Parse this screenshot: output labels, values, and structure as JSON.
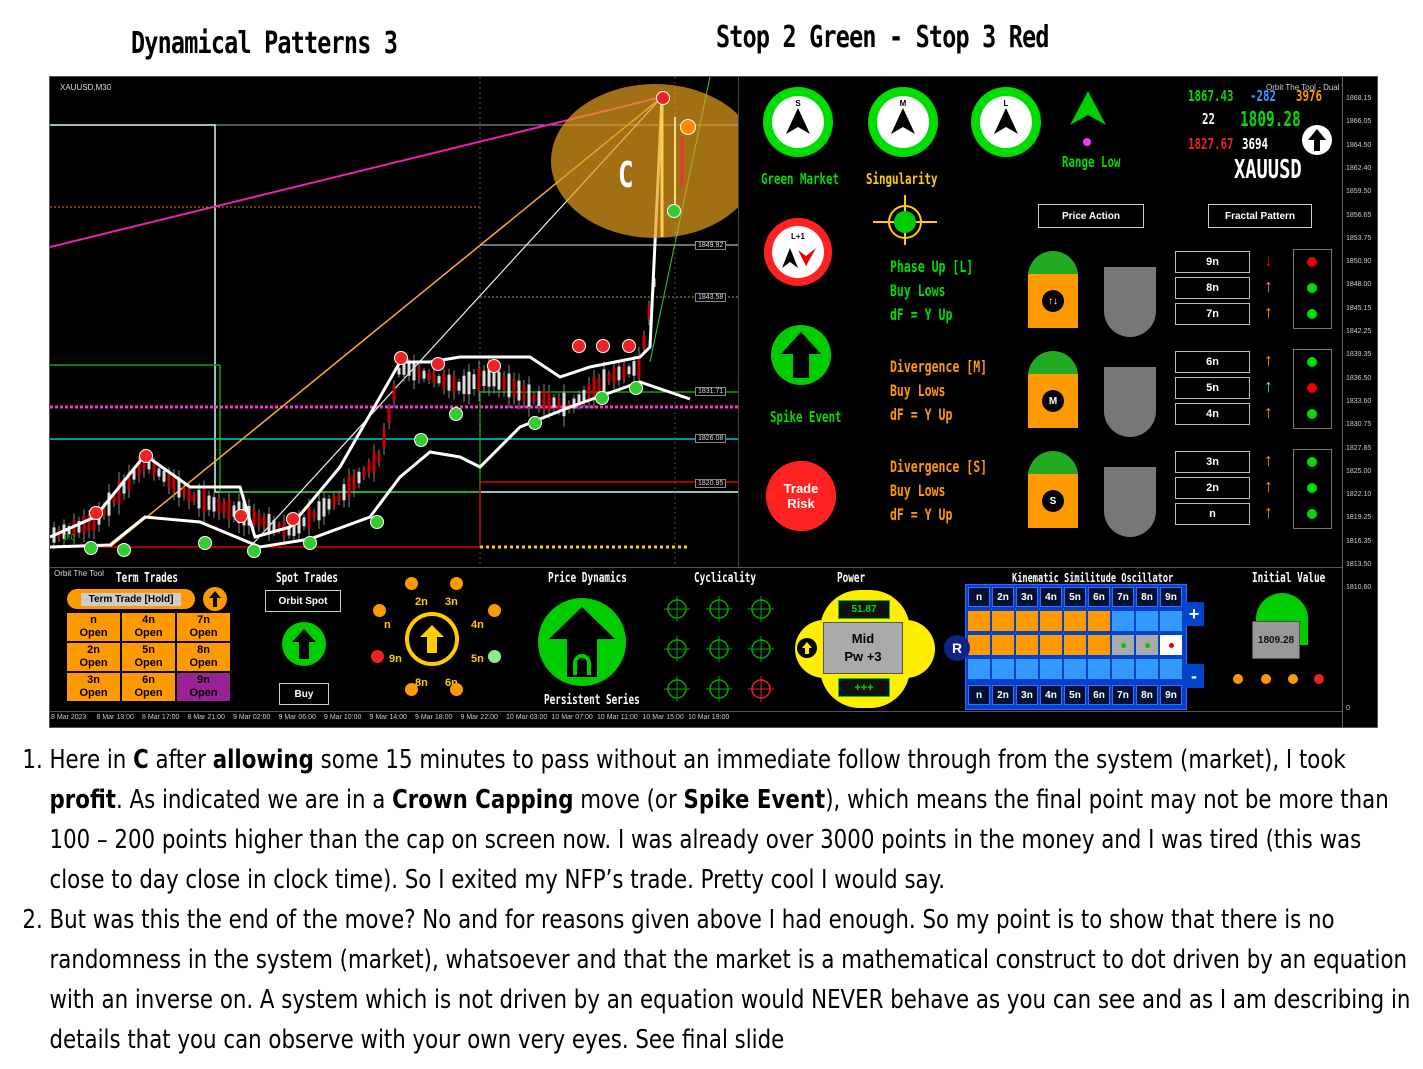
{
  "titles": {
    "left": "Dynamical Patterns 3",
    "right": "Stop 2 Green - Stop 3 Red"
  },
  "chart": {
    "symbol": "XAUUSD,M30",
    "tool_label": "Orbit The Tool - Dual",
    "region_label": "C",
    "price_labels": [
      "1868.15",
      "1866.05",
      "1864.50",
      "1862.40",
      "1859.50",
      "1856.65",
      "1853.75",
      "1850.90",
      "1848.00",
      "1845.15",
      "1842.25",
      "1839.35",
      "1836.50",
      "1833.60",
      "1830.75",
      "1827.85",
      "1825.00",
      "1822.10",
      "1819.25",
      "1816.35",
      "1813.50",
      "1810.60",
      "0"
    ],
    "level_tags": [
      "1849.92",
      "1843.58",
      "1831.71",
      "1826.08",
      "1820.95"
    ],
    "time_labels": [
      "8 Mar 2023",
      "8 Mar 13:00",
      "8 Mar 17:00",
      "8 Mar 21:00",
      "9 Mar 02:00",
      "9 Mar 06:00",
      "9 Mar 10:00",
      "9 Mar 14:00",
      "9 Mar 18:00",
      "9 Mar 22:00",
      "10 Mar 03:00",
      "10 Mar 07:00",
      "10 Mar 11:00",
      "10 Mar 15:00",
      "10 Mar 19:00"
    ],
    "fib_label": "0.0"
  },
  "panel": {
    "compass": [
      {
        "letter": "S",
        "label": "Green Market"
      },
      {
        "letter": "M",
        "label": "Singularity"
      },
      {
        "letter": "L",
        "label": ""
      }
    ],
    "range_low": "Range Low",
    "quote": {
      "v1": "1867.43",
      "v2": "-282",
      "v3": "3976",
      "v4": "22",
      "price": "1809.28",
      "v5": "1827.67",
      "v6": "3694",
      "symbol": "XAUUSD"
    },
    "price_action": "Price Action",
    "fractal_pattern": "Fractal Pattern",
    "lplus": "L+1",
    "spike_event": "Spike Event",
    "trade_risk": "Trade Risk",
    "blocks": [
      {
        "lines": [
          "Phase Up [L]",
          "Buy Lows",
          "dF = Y Up"
        ],
        "icon": "↑↓",
        "rows": [
          {
            "n": "9n",
            "arrow": "↓",
            "ac": "#e00",
            "dc": "#e00"
          },
          {
            "n": "8n",
            "arrow": "↑",
            "ac": "#f90",
            "dc": "#0d0"
          },
          {
            "n": "7n",
            "arrow": "↑",
            "ac": "#f90",
            "dc": "#0d0"
          }
        ]
      },
      {
        "lines": [
          "Divergence [M]",
          "Buy Lows",
          "dF = Y Up"
        ],
        "icon": "M",
        "rows": [
          {
            "n": "6n",
            "arrow": "↑",
            "ac": "#f90",
            "dc": "#0d0"
          },
          {
            "n": "5n",
            "arrow": "↑",
            "ac": "#6e6",
            "dc": "#e00"
          },
          {
            "n": "4n",
            "arrow": "↑",
            "ac": "#f90",
            "dc": "#0d0"
          }
        ]
      },
      {
        "lines": [
          "Divergence [S]",
          "Buy Lows",
          "dF = Y Up"
        ],
        "icon": "S",
        "rows": [
          {
            "n": "3n",
            "arrow": "↑",
            "ac": "#f90",
            "dc": "#0d0"
          },
          {
            "n": "2n",
            "arrow": "↑",
            "ac": "#f90",
            "dc": "#0d0"
          },
          {
            "n": "n",
            "arrow": "↑",
            "ac": "#f90",
            "dc": "#0d0"
          }
        ]
      }
    ]
  },
  "bottom": {
    "orbit_tool": "Orbit The Tool",
    "term_trades": "Term Trades",
    "term_trade_hold": "Term Trade [Hold]",
    "term_grid": [
      [
        "n",
        "Open"
      ],
      [
        "4n",
        "Open"
      ],
      [
        "7n",
        "Open"
      ],
      [
        "2n",
        "Open"
      ],
      [
        "5n",
        "Open"
      ],
      [
        "8n",
        "Open"
      ],
      [
        "3n",
        "Open"
      ],
      [
        "6n",
        "Open"
      ],
      [
        "9n",
        "Open"
      ]
    ],
    "spot_trades": "Spot Trades",
    "orbit_spot": "Orbit Spot",
    "buy": "Buy",
    "cycle_labels": [
      "2n",
      "3n",
      "n",
      "4n",
      "9n",
      "5n",
      "8n",
      "6n"
    ],
    "price_dynamics": "Price Dynamics",
    "persistent_series": "Persistent Series",
    "cyclicality": "Cyclicality",
    "power": "Power",
    "power_value": "51.87",
    "power_mid": "Mid",
    "power_pw": "Pw +3",
    "power_plus": "+++",
    "kso": "Kinematic Similitude Oscillator",
    "kso_headers": [
      "n",
      "2n",
      "3n",
      "4n",
      "5n",
      "6n",
      "7n",
      "8n",
      "9n"
    ],
    "kso_r": "R",
    "kso_plus": "+",
    "kso_minus": "-",
    "initial_value": "Initial Value",
    "initial_price": "1809.28"
  },
  "notes": [
    {
      "segments": [
        {
          "t": "Here in ",
          "b": false
        },
        {
          "t": "C",
          "b": true
        },
        {
          "t": " after ",
          "b": false
        },
        {
          "t": "allowing",
          "b": true
        },
        {
          "t": " some 15 minutes to pass without an immediate  follow through  from  the system (market), I took ",
          "b": false
        },
        {
          "t": "profit",
          "b": true
        },
        {
          "t": ". As indicated  we are in a ",
          "b": false
        },
        {
          "t": "Crown Capping",
          "b": true
        },
        {
          "t": " move (or ",
          "b": false
        },
        {
          "t": "Spike Event",
          "b": true
        },
        {
          "t": "), which means the final point may not be more than 100 – 200 points higher than the cap on screen now. I was already  over 3000 points in the money and I was tired (this was close to day close in clock  time). So I exited my NFP’s trade. Pretty cool I would say.",
          "b": false
        }
      ]
    },
    {
      "segments": [
        {
          "t": "But was this the end of the move? No and for reasons  given above I had enough. So my point is to show that there is no randomness  in the system (market), whatsoever and that the market is a mathematical  construct to dot driven by an equation with an inverse  on. A system which is not driven by an equation would NEVER behave as you can see and as I am describing in details  that you can observe  with your own very eyes. See final slide",
          "b": false
        }
      ]
    }
  ]
}
